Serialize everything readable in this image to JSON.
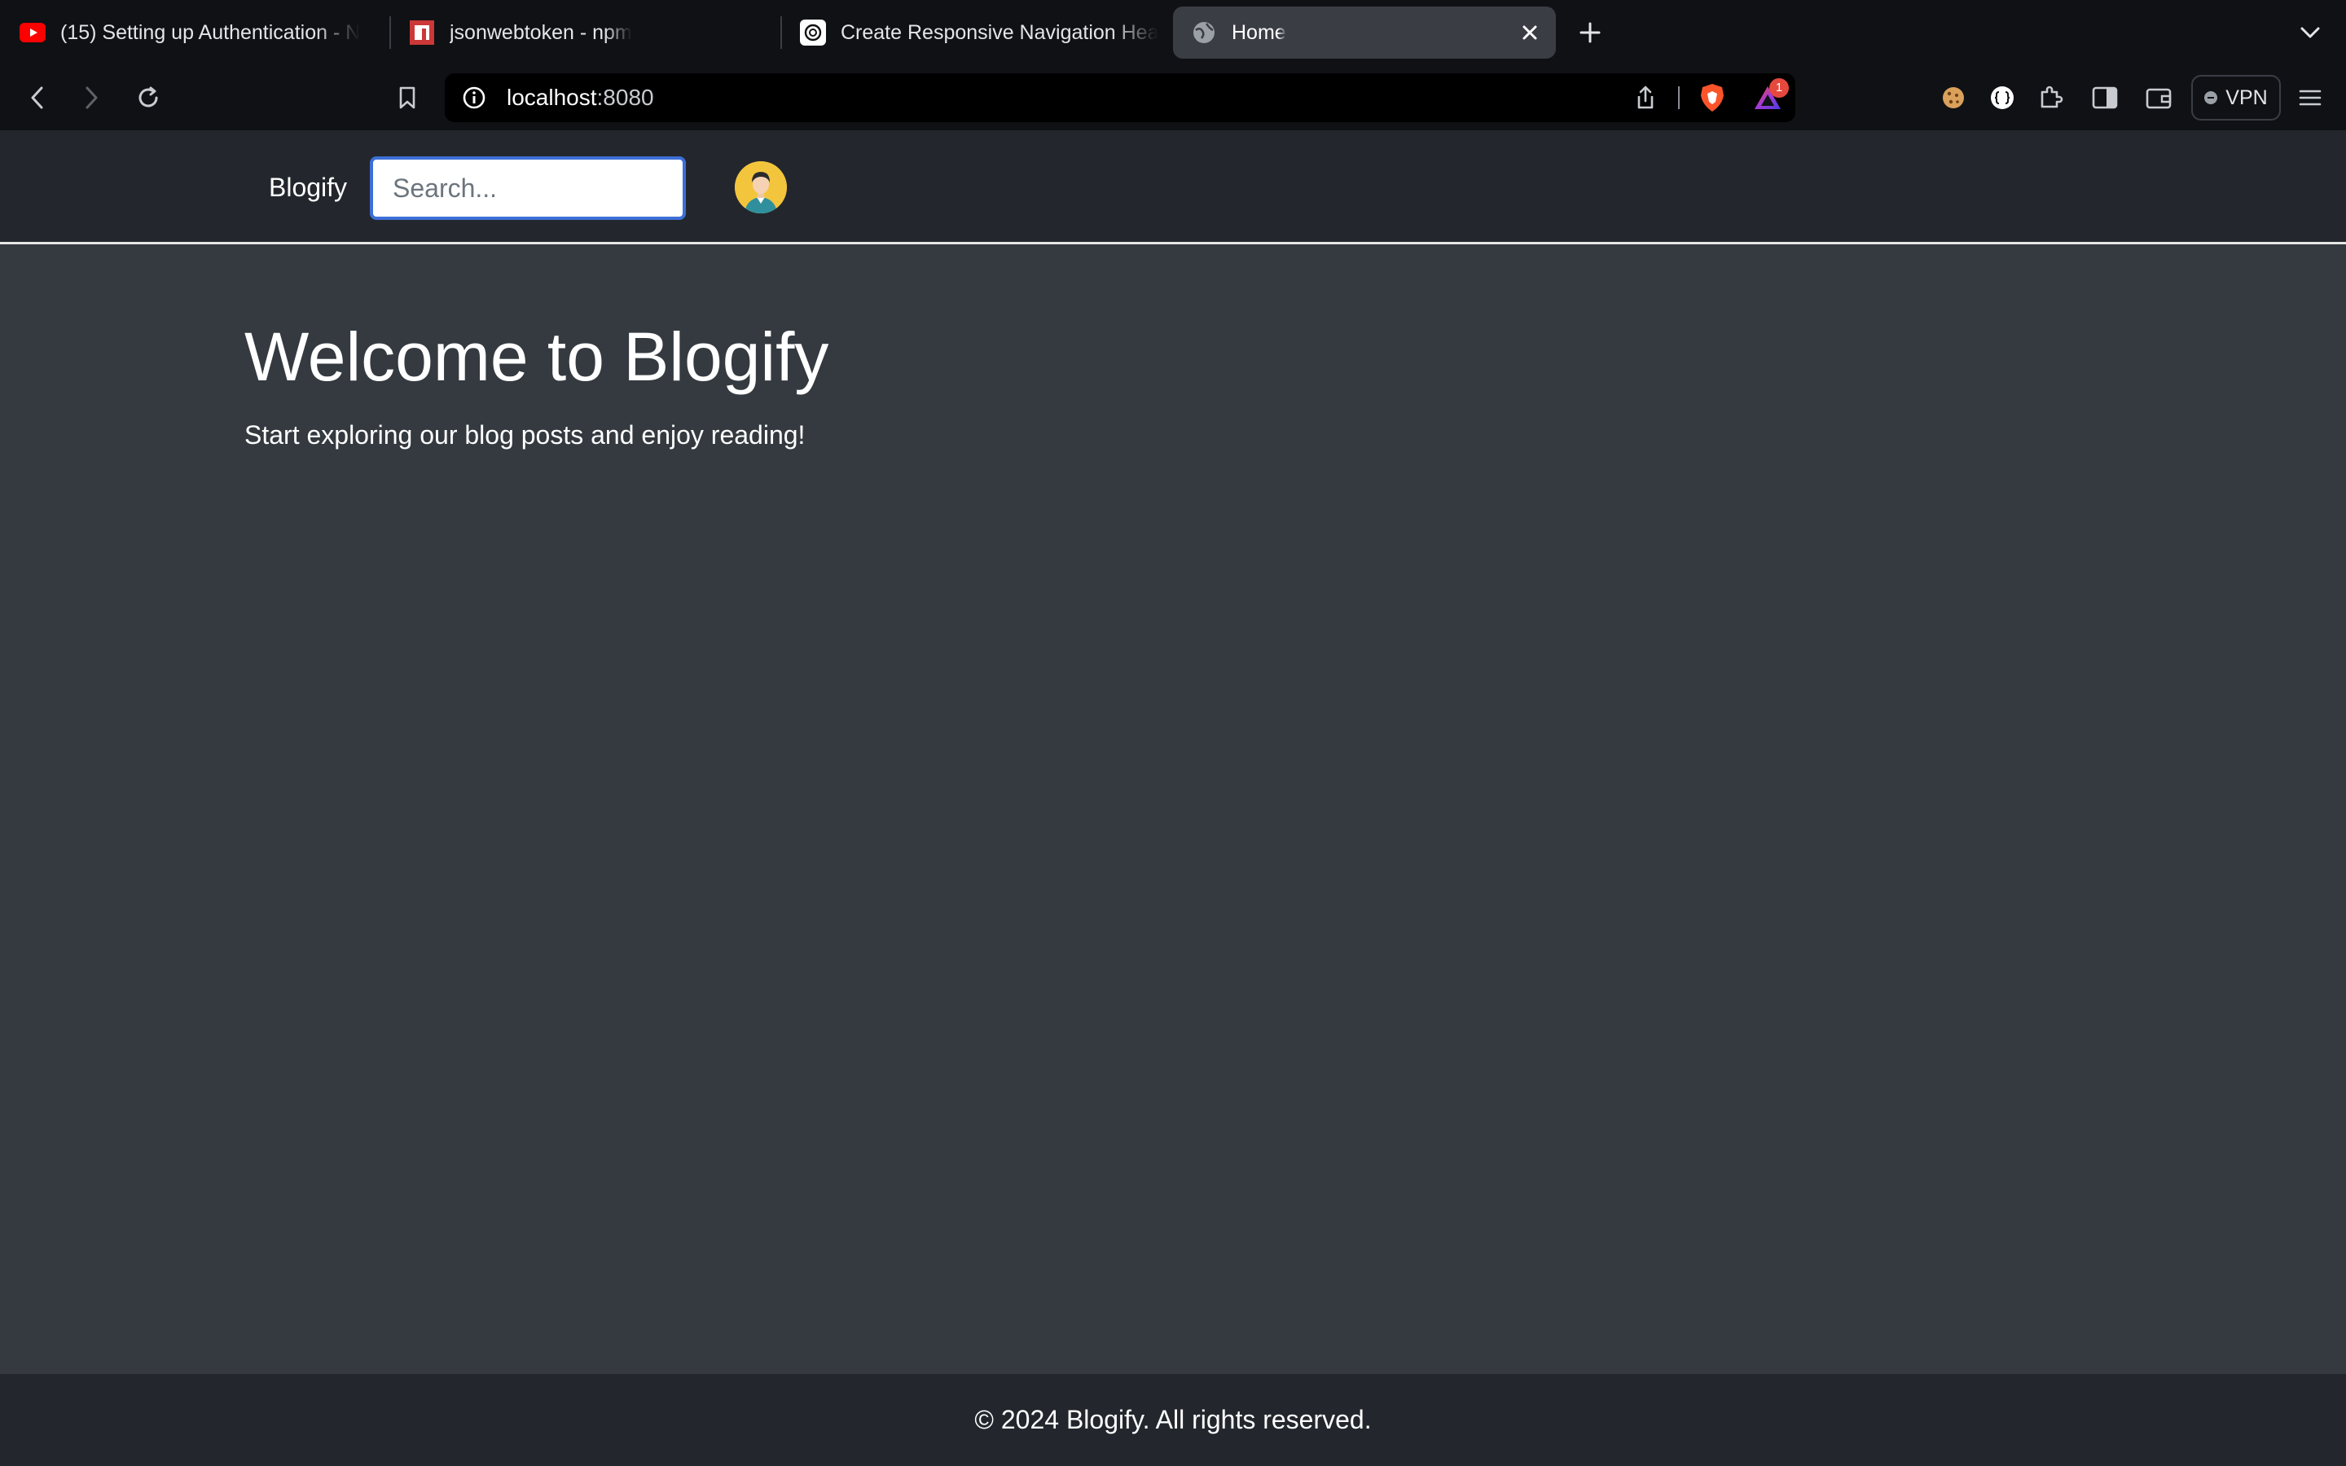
{
  "browser": {
    "tabs": [
      {
        "title": "(15) Setting up Authentication - N",
        "favicon": "youtube-icon",
        "active": false
      },
      {
        "title": "jsonwebtoken - npm",
        "favicon": "npm-icon",
        "active": false
      },
      {
        "title": "Create Responsive Navigation Hea",
        "favicon": "chatgpt-icon",
        "active": false
      },
      {
        "title": "Home",
        "favicon": "globe-icon",
        "active": true
      }
    ],
    "address": {
      "host": "localhost",
      "port": ":8080"
    },
    "rewards_badge": "1",
    "vpn_label": "VPN"
  },
  "site": {
    "brand": "Blogify",
    "search_placeholder": "Search...",
    "hero": {
      "title": "Welcome to Blogify",
      "subtitle": "Start exploring our blog posts and enjoy reading!"
    },
    "footer": "© 2024 Blogify. All rights reserved."
  },
  "colors": {
    "page_bg": "#343a40",
    "header_bg": "#23272d",
    "search_focus": "#3d6fd6",
    "avatar_bg": "#f2c53d"
  }
}
